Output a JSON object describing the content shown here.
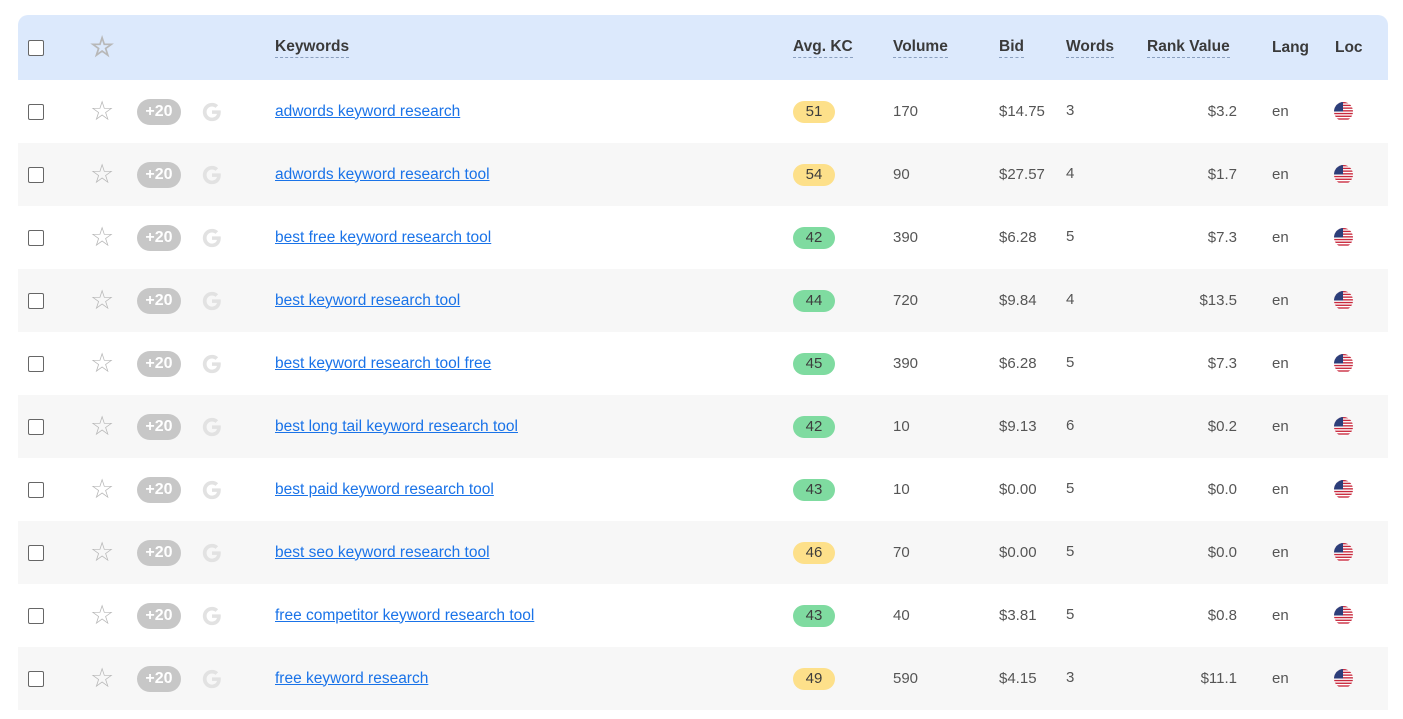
{
  "header": {
    "keywords": "Keywords",
    "avg_kc": "Avg. KC",
    "volume": "Volume",
    "bid": "Bid",
    "words": "Words",
    "rank_value": "Rank Value",
    "lang": "Lang",
    "loc": "Loc"
  },
  "icons": {
    "star": "star-icon",
    "google": "google-icon",
    "flag": "us-flag-icon"
  },
  "colors": {
    "header_bg": "#dce9fc",
    "kc_yellow": "#fde08a",
    "kc_green": "#7fdba0",
    "link": "#1a73e8"
  },
  "rows": [
    {
      "plus": "+20",
      "keyword": "adwords keyword research",
      "kc": "51",
      "kc_color": "yellow",
      "volume": "170",
      "bid": "$14.75",
      "words": "3",
      "rank": "$3.2",
      "lang": "en"
    },
    {
      "plus": "+20",
      "keyword": "adwords keyword research tool",
      "kc": "54",
      "kc_color": "yellow",
      "volume": "90",
      "bid": "$27.57",
      "words": "4",
      "rank": "$1.7",
      "lang": "en"
    },
    {
      "plus": "+20",
      "keyword": "best free keyword research tool",
      "kc": "42",
      "kc_color": "green",
      "volume": "390",
      "bid": "$6.28",
      "words": "5",
      "rank": "$7.3",
      "lang": "en"
    },
    {
      "plus": "+20",
      "keyword": "best keyword research tool",
      "kc": "44",
      "kc_color": "green",
      "volume": "720",
      "bid": "$9.84",
      "words": "4",
      "rank": "$13.5",
      "lang": "en"
    },
    {
      "plus": "+20",
      "keyword": "best keyword research tool free",
      "kc": "45",
      "kc_color": "green",
      "volume": "390",
      "bid": "$6.28",
      "words": "5",
      "rank": "$7.3",
      "lang": "en"
    },
    {
      "plus": "+20",
      "keyword": "best long tail keyword research tool",
      "kc": "42",
      "kc_color": "green",
      "volume": "10",
      "bid": "$9.13",
      "words": "6",
      "rank": "$0.2",
      "lang": "en"
    },
    {
      "plus": "+20",
      "keyword": "best paid keyword research tool",
      "kc": "43",
      "kc_color": "green",
      "volume": "10",
      "bid": "$0.00",
      "words": "5",
      "rank": "$0.0",
      "lang": "en"
    },
    {
      "plus": "+20",
      "keyword": "best seo keyword research tool",
      "kc": "46",
      "kc_color": "yellow",
      "volume": "70",
      "bid": "$0.00",
      "words": "5",
      "rank": "$0.0",
      "lang": "en"
    },
    {
      "plus": "+20",
      "keyword": "free competitor keyword research tool",
      "kc": "43",
      "kc_color": "green",
      "volume": "40",
      "bid": "$3.81",
      "words": "5",
      "rank": "$0.8",
      "lang": "en"
    },
    {
      "plus": "+20",
      "keyword": "free keyword research",
      "kc": "49",
      "kc_color": "yellow",
      "volume": "590",
      "bid": "$4.15",
      "words": "3",
      "rank": "$11.1",
      "lang": "en"
    }
  ]
}
